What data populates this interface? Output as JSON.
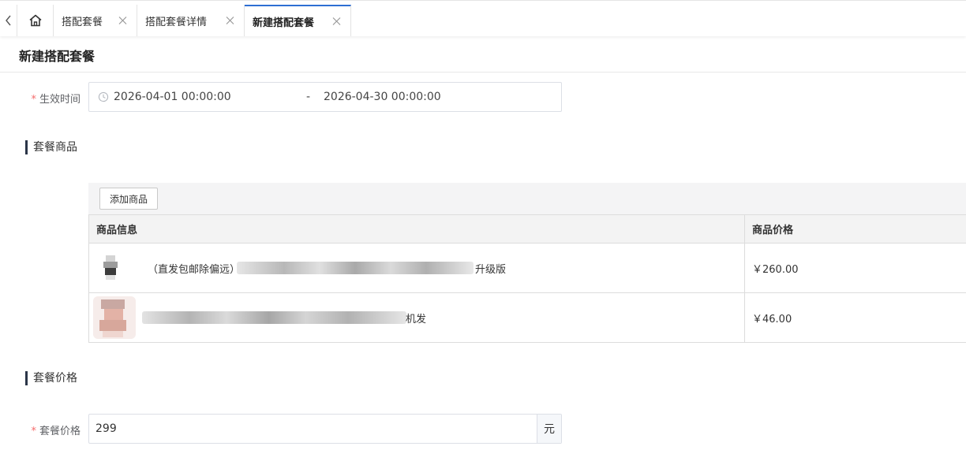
{
  "tabs": [
    {
      "label": "搭配套餐",
      "active": false
    },
    {
      "label": "搭配套餐详情",
      "active": false
    },
    {
      "label": "新建搭配套餐",
      "active": true
    }
  ],
  "page": {
    "title": "新建搭配套餐"
  },
  "form": {
    "required_mark": "*",
    "effective_time": {
      "label": "生效时间",
      "start": "2026-04-01 00:00:00",
      "separator": "-",
      "end": "2026-04-30 00:00:00"
    },
    "package_price": {
      "label": "套餐价格",
      "value": "299",
      "unit": "元"
    }
  },
  "sections": {
    "products": "套餐商品",
    "price": "套餐价格"
  },
  "products_table": {
    "add_button": "添加商品",
    "columns": [
      "商品信息",
      "商品价格"
    ],
    "rows": [
      {
        "name_prefix": "（直发包邮除偏远）",
        "name_suffix": "升级版",
        "price": "￥260.00"
      },
      {
        "name_prefix": "",
        "name_suffix": "机发",
        "price": "￥46.00"
      }
    ]
  },
  "colors": {
    "accent": "#2d6fd3",
    "required": "#f56c6c",
    "section_bar": "#2b3548"
  },
  "icons": [
    "chevron-left-icon",
    "home-icon",
    "close-icon",
    "clock-icon"
  ]
}
